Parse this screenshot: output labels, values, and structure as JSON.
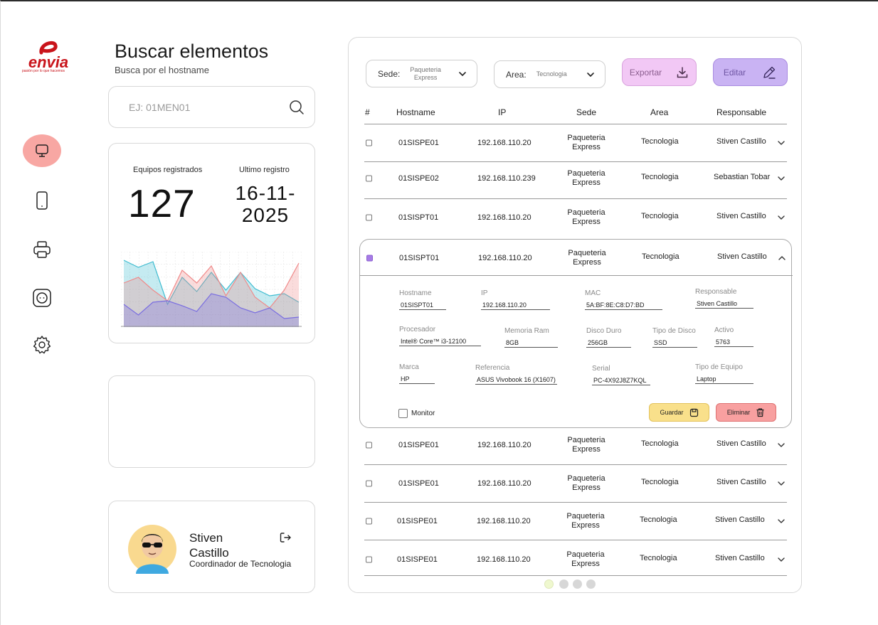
{
  "brand": {
    "logo_text": "envia",
    "tagline": "pasión por lo que hacemos",
    "color": "#c9141b"
  },
  "nav": [
    {
      "icon": "monitor-icon",
      "active": true
    },
    {
      "icon": "tablet-icon",
      "active": false
    },
    {
      "icon": "printer-icon",
      "active": false
    },
    {
      "icon": "device-icon",
      "active": false
    },
    {
      "icon": "gear-icon",
      "active": false
    }
  ],
  "header": {
    "title": "Buscar elementos",
    "subtitle": "Busca por el hostname"
  },
  "search": {
    "placeholder": "EJ: 01MEN01",
    "value": ""
  },
  "stats": {
    "registered_label": "Equipos registrados",
    "registered_value": "127",
    "last_label": "Ultimo registro",
    "last_value_line1": "16-11-",
    "last_value_line2": "2025"
  },
  "chart_data": {
    "type": "area",
    "title": "",
    "xlabel": "",
    "ylabel": "",
    "grid": true,
    "ylim": [
      0,
      100
    ],
    "x": [
      0,
      1,
      2,
      3,
      4,
      5,
      6,
      7,
      8,
      9,
      10,
      11,
      12
    ],
    "series": [
      {
        "color": "#3fbcd0",
        "values": [
          92,
          82,
          90,
          30,
          68,
          48,
          75,
          50,
          75,
          52,
          42,
          45,
          33
        ]
      },
      {
        "color": "#f08a8a",
        "values": [
          60,
          68,
          50,
          35,
          78,
          60,
          84,
          42,
          75,
          40,
          25,
          50,
          88
        ]
      },
      {
        "color": "#7a6ee0",
        "values": [
          30,
          15,
          33,
          35,
          28,
          20,
          45,
          40,
          25,
          18,
          25,
          10,
          12
        ]
      }
    ]
  },
  "user": {
    "first_name": "Stiven",
    "last_name": "Castillo",
    "role": "Coordinador de Tecnologia"
  },
  "filters": {
    "sede_label": "Sede:",
    "sede_value_1": "Paqueteria",
    "sede_value_2": "Express",
    "area_label": "Area:",
    "area_value": "Tecnologia"
  },
  "actions": {
    "export": "Exportar",
    "edit": "Editar"
  },
  "table": {
    "headers": {
      "num": "#",
      "hostname": "Hostname",
      "ip": "IP",
      "sede": "Sede",
      "area": "Area",
      "responsable": "Responsable"
    },
    "rows": [
      {
        "hostname": "01SISPE01",
        "ip": "192.168.110.20",
        "sede_1": "Paqueteria",
        "sede_2": "Express",
        "area": "Tecnologia",
        "responsable": "Stiven Castillo"
      },
      {
        "hostname": "01SISPE02",
        "ip": "192.168.110.239",
        "sede_1": "Paqueteria",
        "sede_2": "Express",
        "area": "Tecnologia",
        "responsable": "Sebastian Tobar"
      },
      {
        "hostname": "01SISPT01",
        "ip": "192.168.110.20",
        "sede_1": "Paqueteria",
        "sede_2": "Express",
        "area": "Tecnologia",
        "responsable": "Stiven Castillo"
      },
      {
        "hostname": "01SISPT01",
        "ip": "192.168.110.20",
        "sede_1": "Paqueteria",
        "sede_2": "Express",
        "area": "Tecnologia",
        "responsable": "Stiven Castillo",
        "expanded": true
      },
      {
        "hostname": "01SISPE01",
        "ip": "192.168.110.20",
        "sede_1": "Paqueteria",
        "sede_2": "Express",
        "area": "Tecnologia",
        "responsable": "Stiven Castillo"
      },
      {
        "hostname": "01SISPE01",
        "ip": "192.168.110.20",
        "sede_1": "Paqueteria",
        "sede_2": "Express",
        "area": "Tecnologia",
        "responsable": "Stiven Castillo"
      },
      {
        "hostname": "01SISPE01",
        "ip": "192.168.110.20",
        "sede_1": "Paqueteria",
        "sede_2": "Express",
        "area": "Tecnologia",
        "responsable": "Stiven Castillo"
      },
      {
        "hostname": "01SISPE01",
        "ip": "192.168.110.20",
        "sede_1": "Paqueteria",
        "sede_2": "Express",
        "area": "Tecnologia",
        "responsable": "Stiven Castillo"
      }
    ]
  },
  "detail": {
    "hostname_label": "Hostname",
    "hostname": "01SISPT01",
    "ip_label": "IP",
    "ip": "192.168.110.20",
    "mac_label": "MAC",
    "mac": "5A:BF:8E:C8:D7:BD",
    "responsable_label": "Responsable",
    "responsable": "Stiven Castillo",
    "procesador_label": "Procesador",
    "procesador": "Intel® Core™ i3-12100",
    "ram_label": "Memoria Ram",
    "ram": "8GB",
    "disco_label": "Disco Duro",
    "disco": "256GB",
    "tipo_disco_label": "Tipo de Disco",
    "tipo_disco": "SSD",
    "activo_label": "Activo",
    "activo": "5763",
    "marca_label": "Marca",
    "marca": "HP",
    "referencia_label": "Referencia",
    "referencia": "ASUS Vivobook 16 (X1607)",
    "serial_label": "Serial",
    "serial": "PC-4X92J8Z7KQL",
    "tipo_equipo_label": "Tipo de Equipo",
    "tipo_equipo": "Laptop",
    "monitor_label": "Monitor",
    "monitor_checked": false,
    "guardar": "Guardar",
    "eliminar": "Eliminar"
  },
  "pagination": {
    "pages": 4,
    "current": 1
  }
}
